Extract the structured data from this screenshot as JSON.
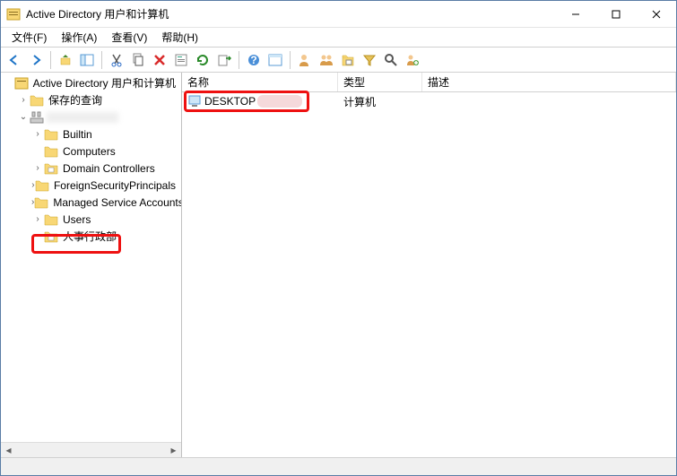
{
  "window": {
    "title": "Active Directory 用户和计算机"
  },
  "menu": {
    "file": "文件(F)",
    "action": "操作(A)",
    "view": "查看(V)",
    "help": "帮助(H)"
  },
  "tree": {
    "root": "Active Directory 用户和计算机",
    "saved_queries": "保存的查询",
    "domain": "",
    "builtin": "Builtin",
    "computers": "Computers",
    "domain_controllers": "Domain Controllers",
    "fsp": "ForeignSecurityPrincipals",
    "msa": "Managed Service Accounts",
    "users": "Users",
    "hr_ou": "人事行政部"
  },
  "list": {
    "columns": {
      "name": "名称",
      "type": "类型",
      "desc": "描述"
    },
    "rows": [
      {
        "name": "DESKTOP",
        "type": "计算机",
        "desc": ""
      }
    ]
  }
}
